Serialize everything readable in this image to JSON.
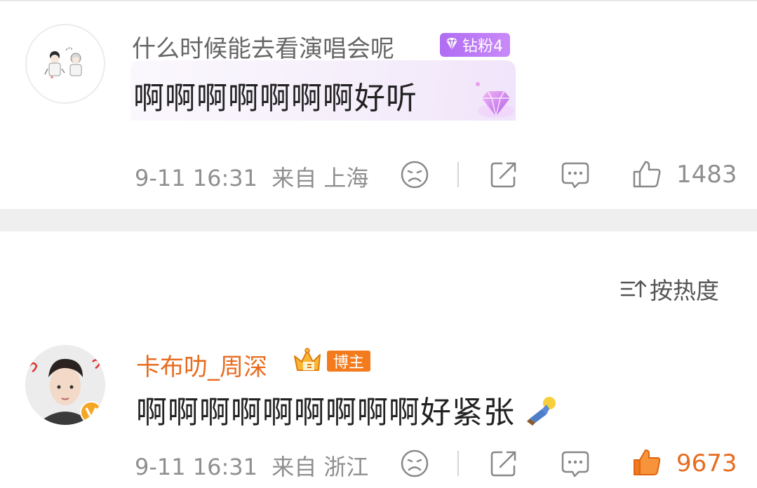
{
  "comments": [
    {
      "username": "什么时候能去看演唱会呢",
      "badge": "钻粉4",
      "text": "啊啊啊啊啊啊啊好听",
      "time": "9-11 16:31",
      "location": "来自 上海",
      "likes": "1483",
      "liked": false
    },
    {
      "username": "卡布叻_周深",
      "badge": "博主",
      "text": "啊啊啊啊啊啊啊啊啊好紧张",
      "time": "9-11 16:31",
      "location": "来自 浙江",
      "likes": "9673",
      "liked": true
    }
  ],
  "sort": {
    "label": "按热度"
  },
  "colors": {
    "accent_orange": "#e86b1f",
    "fan_badge_purple": "#b06cf3",
    "meta_gray": "#8f8f8f",
    "separator": "#efefef"
  },
  "icons": [
    "sad-face-icon",
    "share-icon",
    "comment-icon",
    "thumbs-up-icon",
    "sort-icon",
    "diamond-icon",
    "crown-icon",
    "verified-v-icon"
  ]
}
